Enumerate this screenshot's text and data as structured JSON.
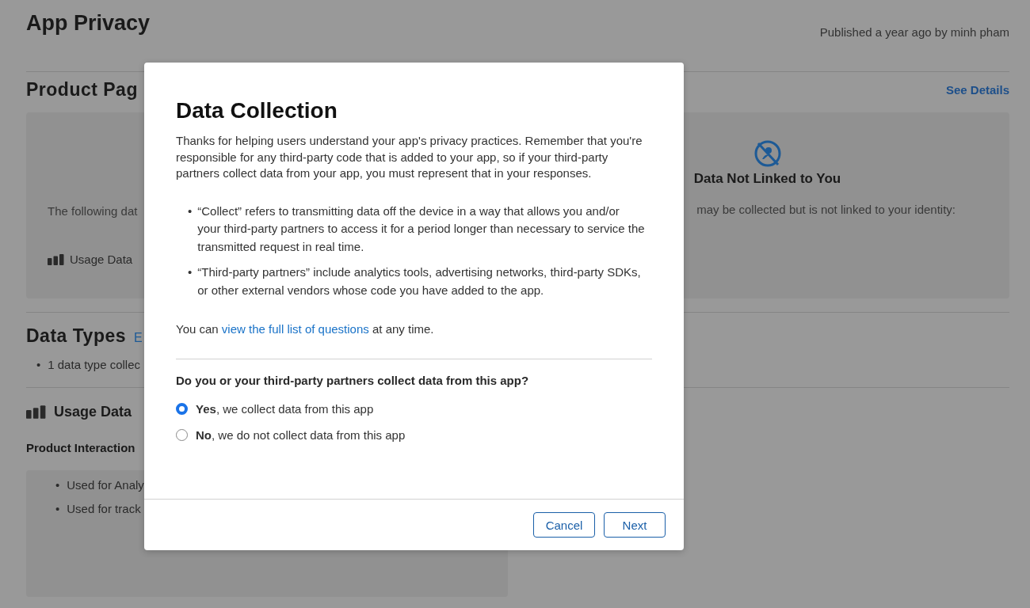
{
  "page": {
    "title": "App Privacy",
    "published": "Published a year ago by minh pham",
    "product_page": {
      "heading": "Product Pag",
      "link": "See Details",
      "linked_card": {
        "text": "The following dat",
        "items": [
          "Usage Data"
        ]
      },
      "not_linked_card": {
        "title": "Data Not Linked to You",
        "text": "may be collected but is not linked to your identity:"
      }
    },
    "data_types": {
      "heading": "Data Types",
      "link": "E",
      "bullets": [
        {
          "marker": "•",
          "text": "1 data type collec"
        }
      ]
    },
    "usage_data": {
      "heading": "Usage Data",
      "subheading": "Product Interaction",
      "bullets": [
        {
          "marker": "•",
          "text": "Used for Analy"
        },
        {
          "marker": "•",
          "text": "Used for track"
        }
      ]
    }
  },
  "dialog": {
    "title": "Data Collection",
    "intro": "Thanks for helping users understand your app's privacy practices. Remember that you're responsible for any third-party code that is added to your app, so if your third-party partners collect data from your app, you must represent that in your responses.",
    "bullets": [
      {
        "marker": "•",
        "text": "“Collect” refers to transmitting data off the device in a way that allows you and/or your third-party partners to access it for a period longer than necessary to service the transmitted request in real time."
      },
      {
        "marker": "•",
        "text": "“Third-party partners” include analytics tools, advertising networks, third-party SDKs, or other external vendors whose code you have added to the app."
      }
    ],
    "note": {
      "before": "You can ",
      "link": "view the full list of questions",
      "after": " at any time."
    },
    "question": "Do you or your third-party partners collect data from this app?",
    "options": [
      {
        "label": "**Yes**, we collect data from this app",
        "selected": true
      },
      {
        "label": "**No**, we do not collect data from this app",
        "selected": false
      }
    ],
    "buttons": [
      "Cancel",
      "Next"
    ]
  }
}
